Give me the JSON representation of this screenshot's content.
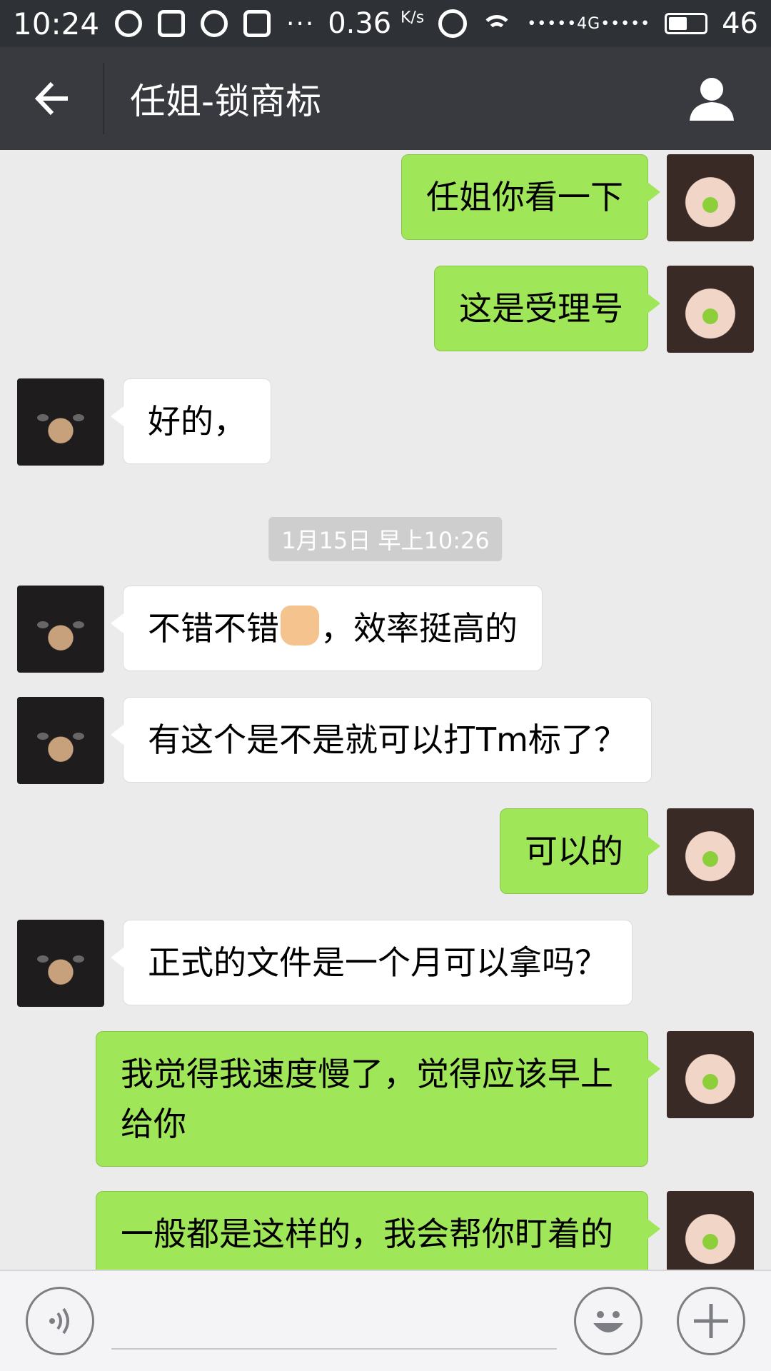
{
  "status_bar": {
    "time": "10:24",
    "network_speed": "0.36",
    "speed_unit": "K/s",
    "signal": "•••••4G•••••",
    "battery": "46"
  },
  "header": {
    "title": "任姐-锁商标",
    "back_icon": "arrow-left-icon",
    "profile_icon": "person-icon"
  },
  "messages": [
    {
      "from": "me",
      "text": "任姐你看一下"
    },
    {
      "from": "me",
      "text": "这是受理号"
    },
    {
      "from": "other",
      "text": "好的，"
    },
    {
      "type": "timestamp",
      "text": "1月15日 早上10:26"
    },
    {
      "from": "other",
      "text_before": "不错不错",
      "emoji": "thumbs-up",
      "text_after": "，效率挺高的"
    },
    {
      "from": "other",
      "text": "有这个是不是就可以打Tm标了？"
    },
    {
      "from": "me",
      "text": "可以的"
    },
    {
      "from": "other",
      "text": "正式的文件是一个月可以拿吗？"
    },
    {
      "from": "me",
      "line1": "我觉得我速度慢了，觉得应该早上",
      "line2": "给你"
    },
    {
      "from": "me",
      "text": "一般都是这样的，我会帮你盯着的"
    }
  ],
  "input_bar": {
    "voice_icon": "voice-icon",
    "emoji_icon": "smiley-icon",
    "plus_icon": "plus-icon",
    "placeholder": ""
  },
  "colors": {
    "bubble_me": "#9fe658",
    "bubble_other": "#ffffff",
    "header_bg": "#393a3f",
    "chat_bg": "#ebebeb"
  }
}
